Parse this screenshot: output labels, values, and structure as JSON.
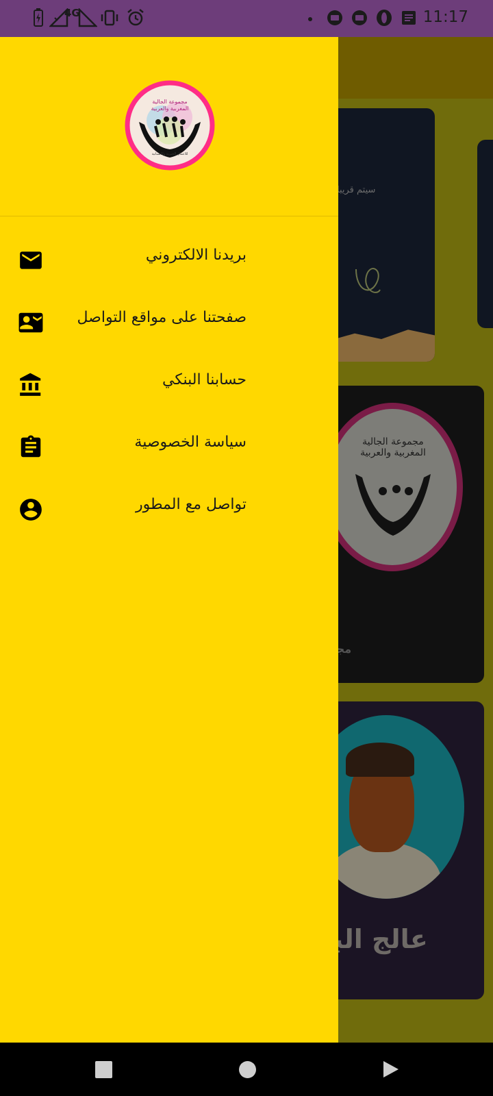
{
  "status_bar": {
    "time": "11:17",
    "network": "4G"
  },
  "background": {
    "card1_text": "سيتم قريبا",
    "card2_logo_title": "مجموعة الجالية المغربية والعربية",
    "card2_caption": "مجموع",
    "card3_caption": "عالج البد"
  },
  "drawer": {
    "logo": {
      "top_text": "مجموعة الجالية المغربية والعربية",
      "bottom_text": "للاعمال الخيرية والانسانية"
    },
    "items": [
      {
        "label": "بريدنا الالكتروني",
        "icon": "email-icon"
      },
      {
        "label": "صفحتنا على مواقع التواصل",
        "icon": "contact-card-icon"
      },
      {
        "label": "حسابنا البنكي",
        "icon": "bank-icon"
      },
      {
        "label": "سياسة الخصوصية",
        "icon": "clipboard-icon"
      },
      {
        "label": "تواصل مع المطور",
        "icon": "account-circle-icon"
      }
    ]
  },
  "colors": {
    "drawer_bg": "#ffd800",
    "status_bar": "#6d3d7a",
    "scrim_bg": "#706c0c",
    "logo_ring": "#ff2d86"
  }
}
